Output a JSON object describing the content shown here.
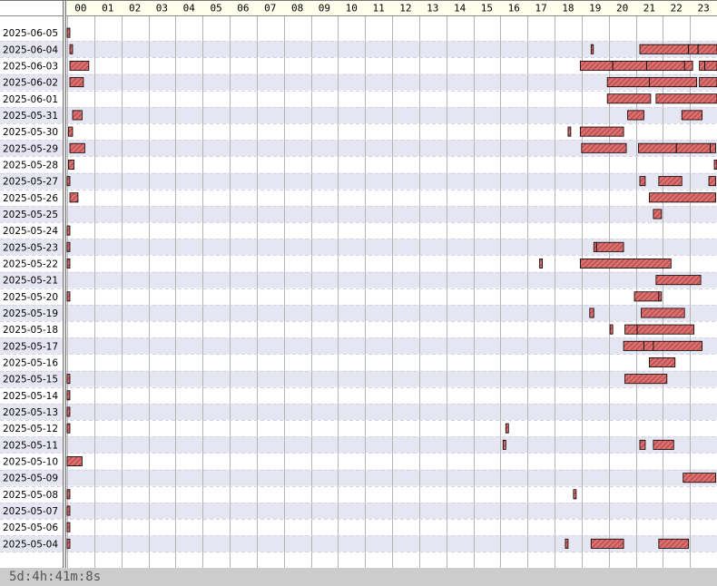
{
  "footer": {
    "duration_text": "5d:4h:41m:8s"
  },
  "colors": {
    "bar_fill": "#d97070",
    "bar_hatch": "#a83232",
    "bar_border": "#000000",
    "row_alt": "#e6e6f2",
    "header_bg": "#ffffee",
    "grid": "#b4b4b4",
    "footer_bg": "#cccccc"
  },
  "chart_data": {
    "type": "gantt-timeline",
    "x_unit": "hour",
    "x_range": [
      0,
      24
    ],
    "hours": [
      "00",
      "01",
      "02",
      "03",
      "04",
      "05",
      "06",
      "07",
      "08",
      "09",
      "10",
      "11",
      "12",
      "13",
      "14",
      "15",
      "16",
      "17",
      "18",
      "19",
      "20",
      "21",
      "22",
      "23"
    ],
    "dates": [
      "2025-06-05",
      "2025-06-04",
      "2025-06-03",
      "2025-06-02",
      "2025-06-01",
      "2025-05-31",
      "2025-05-30",
      "2025-05-29",
      "2025-05-28",
      "2025-05-27",
      "2025-05-26",
      "2025-05-25",
      "2025-05-24",
      "2025-05-23",
      "2025-05-22",
      "2025-05-21",
      "2025-05-20",
      "2025-05-19",
      "2025-05-18",
      "2025-05-17",
      "2025-05-16",
      "2025-05-15",
      "2025-05-14",
      "2025-05-13",
      "2025-05-12",
      "2025-05-11",
      "2025-05-10",
      "2025-05-09",
      "2025-05-08",
      "2025-05-07",
      "2025-05-06",
      "2025-05-04"
    ],
    "intervals": [
      {
        "date": "2025-06-05",
        "start": 0.0,
        "end": 0.1
      },
      {
        "date": "2025-06-04",
        "start": 0.1,
        "end": 0.2
      },
      {
        "date": "2025-06-04",
        "start": 19.35,
        "end": 19.4
      },
      {
        "date": "2025-06-04",
        "start": 21.15,
        "end": 22.95
      },
      {
        "date": "2025-06-04",
        "start": 22.95,
        "end": 23.3
      },
      {
        "date": "2025-06-04",
        "start": 23.3,
        "end": 24.0
      },
      {
        "date": "2025-06-03",
        "start": 0.1,
        "end": 0.8
      },
      {
        "date": "2025-06-03",
        "start": 18.95,
        "end": 20.15
      },
      {
        "date": "2025-06-03",
        "start": 20.15,
        "end": 21.4
      },
      {
        "date": "2025-06-03",
        "start": 21.4,
        "end": 22.8
      },
      {
        "date": "2025-06-03",
        "start": 22.8,
        "end": 23.1
      },
      {
        "date": "2025-06-03",
        "start": 23.35,
        "end": 23.55
      },
      {
        "date": "2025-06-03",
        "start": 23.55,
        "end": 24.0
      },
      {
        "date": "2025-06-02",
        "start": 0.1,
        "end": 0.6
      },
      {
        "date": "2025-06-02",
        "start": 19.95,
        "end": 21.5
      },
      {
        "date": "2025-06-02",
        "start": 21.5,
        "end": 23.25
      },
      {
        "date": "2025-06-02",
        "start": 23.35,
        "end": 24.0
      },
      {
        "date": "2025-06-01",
        "start": 19.95,
        "end": 21.55
      },
      {
        "date": "2025-06-01",
        "start": 21.75,
        "end": 24.0
      },
      {
        "date": "2025-05-31",
        "start": 0.2,
        "end": 0.55
      },
      {
        "date": "2025-05-31",
        "start": 20.7,
        "end": 21.3
      },
      {
        "date": "2025-05-31",
        "start": 22.7,
        "end": 23.45
      },
      {
        "date": "2025-05-30",
        "start": 0.05,
        "end": 0.2
      },
      {
        "date": "2025-05-30",
        "start": 18.5,
        "end": 18.6
      },
      {
        "date": "2025-05-30",
        "start": 18.95,
        "end": 20.55
      },
      {
        "date": "2025-05-29",
        "start": 0.1,
        "end": 0.65
      },
      {
        "date": "2025-05-29",
        "start": 19.0,
        "end": 20.65
      },
      {
        "date": "2025-05-29",
        "start": 21.1,
        "end": 22.5
      },
      {
        "date": "2025-05-29",
        "start": 22.5,
        "end": 23.75
      },
      {
        "date": "2025-05-29",
        "start": 23.75,
        "end": 23.95
      },
      {
        "date": "2025-05-28",
        "start": 0.05,
        "end": 0.25
      },
      {
        "date": "2025-05-28",
        "start": 23.9,
        "end": 24.0
      },
      {
        "date": "2025-05-27",
        "start": 0.0,
        "end": 0.1
      },
      {
        "date": "2025-05-27",
        "start": 21.15,
        "end": 21.35
      },
      {
        "date": "2025-05-27",
        "start": 21.85,
        "end": 22.7
      },
      {
        "date": "2025-05-27",
        "start": 23.7,
        "end": 23.95
      },
      {
        "date": "2025-05-26",
        "start": 0.1,
        "end": 0.4
      },
      {
        "date": "2025-05-26",
        "start": 21.5,
        "end": 23.95
      },
      {
        "date": "2025-05-25",
        "start": 21.65,
        "end": 21.95
      },
      {
        "date": "2025-05-24",
        "start": 0.0,
        "end": 0.1
      },
      {
        "date": "2025-05-23",
        "start": 0.0,
        "end": 0.1
      },
      {
        "date": "2025-05-23",
        "start": 19.45,
        "end": 19.55
      },
      {
        "date": "2025-05-23",
        "start": 19.55,
        "end": 20.55
      },
      {
        "date": "2025-05-22",
        "start": 0.0,
        "end": 0.1
      },
      {
        "date": "2025-05-22",
        "start": 17.45,
        "end": 17.55
      },
      {
        "date": "2025-05-22",
        "start": 18.95,
        "end": 22.3
      },
      {
        "date": "2025-05-21",
        "start": 21.75,
        "end": 23.4
      },
      {
        "date": "2025-05-20",
        "start": 0.0,
        "end": 0.1
      },
      {
        "date": "2025-05-20",
        "start": 20.95,
        "end": 21.85
      },
      {
        "date": "2025-05-20",
        "start": 21.85,
        "end": 21.95
      },
      {
        "date": "2025-05-19",
        "start": 19.3,
        "end": 19.45
      },
      {
        "date": "2025-05-19",
        "start": 21.2,
        "end": 22.8
      },
      {
        "date": "2025-05-18",
        "start": 20.05,
        "end": 20.15
      },
      {
        "date": "2025-05-18",
        "start": 20.6,
        "end": 21.05
      },
      {
        "date": "2025-05-18",
        "start": 21.05,
        "end": 23.15
      },
      {
        "date": "2025-05-17",
        "start": 20.55,
        "end": 21.3
      },
      {
        "date": "2025-05-17",
        "start": 21.3,
        "end": 21.65
      },
      {
        "date": "2025-05-17",
        "start": 21.65,
        "end": 23.45
      },
      {
        "date": "2025-05-16",
        "start": 21.5,
        "end": 22.45
      },
      {
        "date": "2025-05-15",
        "start": 0.0,
        "end": 0.1
      },
      {
        "date": "2025-05-15",
        "start": 20.6,
        "end": 22.15
      },
      {
        "date": "2025-05-14",
        "start": 0.0,
        "end": 0.1
      },
      {
        "date": "2025-05-13",
        "start": 0.0,
        "end": 0.1
      },
      {
        "date": "2025-05-12",
        "start": 0.0,
        "end": 0.1
      },
      {
        "date": "2025-05-12",
        "start": 16.2,
        "end": 16.3
      },
      {
        "date": "2025-05-11",
        "start": 16.1,
        "end": 16.2
      },
      {
        "date": "2025-05-11",
        "start": 21.15,
        "end": 21.35
      },
      {
        "date": "2025-05-11",
        "start": 21.65,
        "end": 22.4
      },
      {
        "date": "2025-05-10",
        "start": 0.0,
        "end": 0.55
      },
      {
        "date": "2025-05-09",
        "start": 22.75,
        "end": 23.95
      },
      {
        "date": "2025-05-08",
        "start": 0.0,
        "end": 0.1
      },
      {
        "date": "2025-05-08",
        "start": 18.7,
        "end": 18.8
      },
      {
        "date": "2025-05-07",
        "start": 0.0,
        "end": 0.1
      },
      {
        "date": "2025-05-06",
        "start": 0.0,
        "end": 0.1
      },
      {
        "date": "2025-05-04",
        "start": 0.0,
        "end": 0.1
      },
      {
        "date": "2025-05-04",
        "start": 18.4,
        "end": 18.5
      },
      {
        "date": "2025-05-04",
        "start": 19.35,
        "end": 20.55
      },
      {
        "date": "2025-05-04",
        "start": 21.85,
        "end": 22.95
      }
    ]
  }
}
